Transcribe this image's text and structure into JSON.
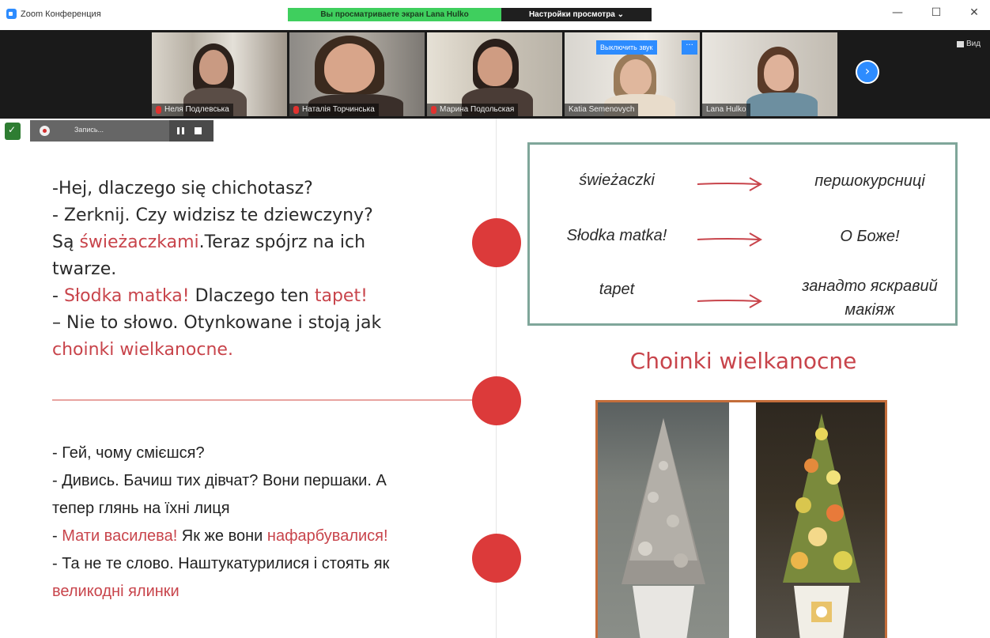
{
  "window": {
    "app_title": "Zoom Конференция",
    "share_status": "Вы просматриваете экран Lana Hulko",
    "view_options": "Настройки просмотра ⌄",
    "controls": {
      "minimize": "—",
      "maximize": "☐",
      "close": "✕"
    }
  },
  "participants": [
    {
      "name": "Неля Подлевська",
      "muted": true
    },
    {
      "name": "Наталія Торчинська",
      "muted": true
    },
    {
      "name": "Марина Подольская",
      "muted": true
    },
    {
      "name": "Katia Semenovych",
      "muted": false
    },
    {
      "name": "Lana Hulko",
      "muted": false
    }
  ],
  "participant_actions": {
    "unmute_label": "Выключить звук",
    "more_label": "···"
  },
  "strip": {
    "next_icon": "›",
    "view_label": "Вид"
  },
  "recording": {
    "label": "Запись..."
  },
  "slide": {
    "polish_dialog": {
      "l1": "-Hej, dlaczego się chichotasz?",
      "l2": "- Zerknij. Czy widzisz te dziewczyny?",
      "l3a": "Są ",
      "l3b": "świeżaczkami",
      "l3c": ".Teraz spójrz na ich",
      "l4": "twarze.",
      "l5a": "- ",
      "l5b": "Słodka matka!",
      "l5c": " Dlaczego ten ",
      "l5d": "tapet!",
      "l6": "– Nie to słowo. Otynkowane i stoją jak",
      "l7": "choinki wielkanocne."
    },
    "ukrainian_dialog": {
      "l1": "- Гей, чому смієшся?",
      "l2": "- Дивись. Бачиш тих дівчат? Вони першаки. А",
      "l3": "тепер глянь на їхні лиця",
      "l4a": "- ",
      "l4b": "Мати василева!",
      "l4c": " Як же вони ",
      "l4d": "нафарбувалися!",
      "l5": "- Та не те слово. Наштукатурилися і стоять як",
      "l6": "великодні ялинки"
    },
    "vocabulary": [
      {
        "term": "świeżaczki",
        "translation": "першокурсниці"
      },
      {
        "term": "Słodka matka!",
        "translation": "О Боже!"
      },
      {
        "term": "tapet",
        "translation_l1": "занадто яскравий",
        "translation_l2": "макіяж"
      }
    ],
    "image_title": "Choinki wielkanocne"
  },
  "colors": {
    "accent_red": "#c8444b",
    "dot_red": "#dc3a3a",
    "zoom_blue": "#2d8cff",
    "share_green": "#3fcf5e",
    "box_border": "#7fa69a"
  }
}
